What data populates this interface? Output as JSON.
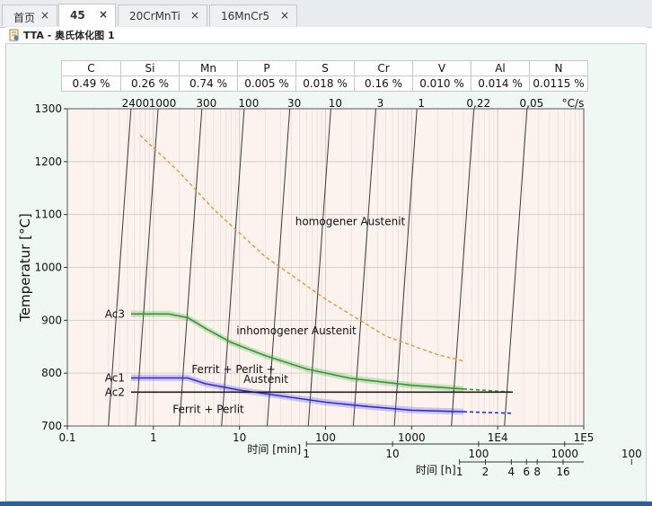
{
  "tabs": [
    {
      "label": "首页",
      "close": "×"
    },
    {
      "label": "45",
      "close": "×",
      "active": true
    },
    {
      "label": "20CrMnTi",
      "close": "×"
    },
    {
      "label": "16MnCr5",
      "close": "×"
    }
  ],
  "page_title": "TTA - 奥氏体化图 1",
  "composition": {
    "elements": [
      "C",
      "Si",
      "Mn",
      "P",
      "S",
      "Cr",
      "V",
      "Al",
      "N"
    ],
    "values": [
      "0.49 %",
      "0.26 %",
      "0.74 %",
      "0.005 %",
      "0.018 %",
      "0.16 %",
      "0.010 %",
      "0.014 %",
      "0.0115 %"
    ]
  },
  "chart_data": {
    "type": "line",
    "xscale": "log",
    "xlim": [
      0.1,
      100000
    ],
    "ylim": [
      700,
      1300
    ],
    "ylabel": "Temperatur [°C]",
    "x_ticks": [
      "0.1",
      "1",
      "10",
      "100",
      "1000",
      "1E4",
      "1E5"
    ],
    "y_ticks": [
      "700",
      "800",
      "900",
      "1000",
      "1100",
      "1200",
      "1300"
    ],
    "secondary_axes": [
      {
        "label": "时间 [min]",
        "ticks": [
          "1",
          "10",
          "100",
          "1000"
        ]
      },
      {
        "label": "时间 [h]",
        "ticks": [
          "1",
          "2",
          "4",
          "6",
          "8",
          "16",
          "100",
          "1000"
        ]
      }
    ],
    "heating_rate_unit": "°C/s",
    "heating_rates": [
      {
        "label": "2400",
        "t_at_700": 0.3
      },
      {
        "label": "1000",
        "t_at_700": 0.62
      },
      {
        "label": "300",
        "t_at_700": 2.0
      },
      {
        "label": "100",
        "t_at_700": 6.2
      },
      {
        "label": "30",
        "t_at_700": 21
      },
      {
        "label": "10",
        "t_at_700": 63
      },
      {
        "label": "3",
        "t_at_700": 210
      },
      {
        "label": "1",
        "t_at_700": 630
      },
      {
        "label": "0,22",
        "t_at_700": 2900
      },
      {
        "label": "0,05",
        "t_at_700": 12000
      }
    ],
    "series": [
      {
        "name": "Ac3",
        "color": "#2e9a2e",
        "style": "solid",
        "band": true,
        "points": [
          [
            0.55,
            912
          ],
          [
            1.5,
            912
          ],
          [
            2.5,
            905
          ],
          [
            4,
            885
          ],
          [
            8,
            858
          ],
          [
            20,
            833
          ],
          [
            60,
            808
          ],
          [
            200,
            790
          ],
          [
            1000,
            777
          ],
          [
            4000,
            770
          ]
        ]
      },
      {
        "name": "Ac3 (extrapolated)",
        "color": "#2e9a2e",
        "style": "dashed",
        "points": [
          [
            4000,
            770
          ],
          [
            15000,
            764
          ]
        ]
      },
      {
        "name": "Ac1",
        "color": "#2c2cdc",
        "style": "solid",
        "band": true,
        "points": [
          [
            0.55,
            791
          ],
          [
            2.5,
            791
          ],
          [
            4,
            780
          ],
          [
            10,
            768
          ],
          [
            30,
            757
          ],
          [
            100,
            745
          ],
          [
            300,
            737
          ],
          [
            1000,
            730
          ],
          [
            4000,
            727
          ]
        ]
      },
      {
        "name": "Ac1 (extrapolated)",
        "color": "#2c2cdc",
        "style": "dashed",
        "points": [
          [
            4000,
            727
          ],
          [
            15000,
            724
          ]
        ]
      },
      {
        "name": "Ac2",
        "color": "#202020",
        "style": "solid",
        "points": [
          [
            0.55,
            764
          ],
          [
            15000,
            764
          ]
        ]
      },
      {
        "name": "homogenisation",
        "color": "#f08c1e",
        "style": "dashed",
        "points": [
          [
            0.7,
            1250
          ],
          [
            2,
            1180
          ],
          [
            5,
            1110
          ],
          [
            20,
            1020
          ],
          [
            100,
            940
          ],
          [
            500,
            870
          ],
          [
            2000,
            835
          ],
          [
            4000,
            823
          ]
        ]
      }
    ],
    "curve_labels": [
      "Ac3",
      "Ac1",
      "Ac2"
    ],
    "annotations": [
      "homogener Austenit",
      "inhomogener Austenit",
      "Ferrit + Perlit +",
      "Austenit",
      "Ferrit + Perlit"
    ]
  }
}
